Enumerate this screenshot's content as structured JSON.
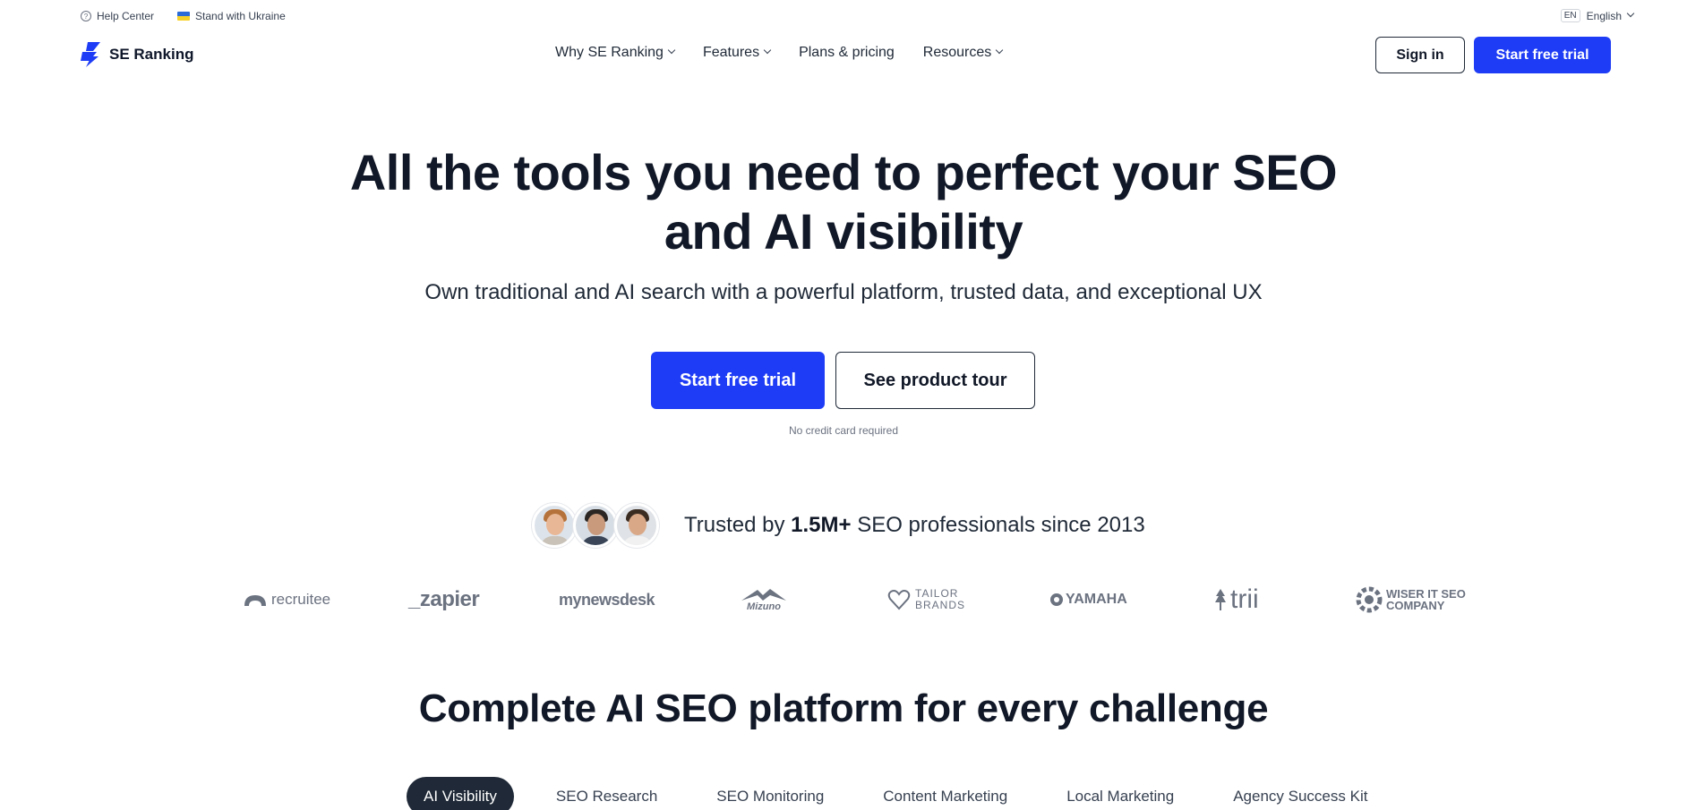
{
  "utility": {
    "help_center": "Help Center",
    "ukraine": "Stand with Ukraine"
  },
  "lang": {
    "code": "EN",
    "label": "English"
  },
  "logo": {
    "text": "SE Ranking"
  },
  "nav": {
    "items": [
      {
        "label": "Why SE Ranking",
        "dropdown": true
      },
      {
        "label": "Features",
        "dropdown": true
      },
      {
        "label": "Plans & pricing",
        "dropdown": false
      },
      {
        "label": "Resources",
        "dropdown": true
      }
    ]
  },
  "header": {
    "signin": "Sign in",
    "trial": "Start free trial"
  },
  "hero": {
    "title_line1": "All the tools you need to perfect your SEO",
    "title_line2": "and AI visibility",
    "subtitle": "Own traditional and AI search with a powerful platform, trusted data, and exceptional UX",
    "cta_trial": "Start free trial",
    "cta_tour": "See product tour",
    "note": "No credit card required"
  },
  "trusted": {
    "prefix": "Trusted by ",
    "count": "1.5M+",
    "suffix": " SEO professionals since 2013"
  },
  "brands": [
    "recruitee",
    "_zapier",
    "mynewsdesk",
    "Mizuno",
    "TAILOR BRANDS",
    "YAMAHA",
    "trii",
    "WISER IT SEO COMPANY"
  ],
  "section": {
    "title": "Complete AI SEO platform for every challenge"
  },
  "tabs": [
    {
      "label": "AI Visibility",
      "active": true
    },
    {
      "label": "SEO Research",
      "active": false
    },
    {
      "label": "SEO Monitoring",
      "active": false
    },
    {
      "label": "Content Marketing",
      "active": false
    },
    {
      "label": "Local Marketing",
      "active": false
    },
    {
      "label": "Agency Success Kit",
      "active": false
    }
  ],
  "colors": {
    "brand_blue": "#1e3cf5",
    "dark": "#111827"
  }
}
